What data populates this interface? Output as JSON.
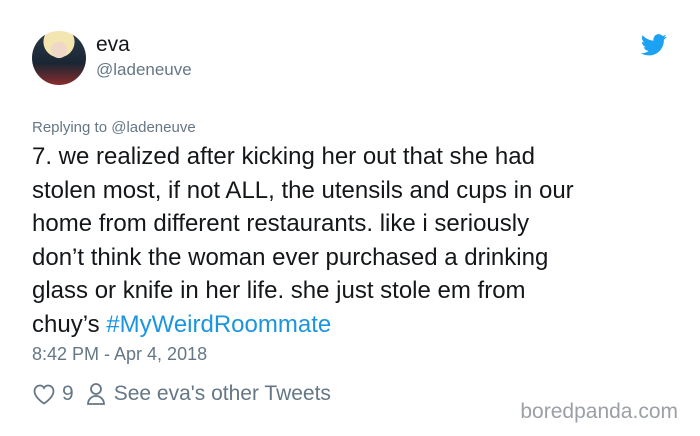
{
  "tweet": {
    "author_name": "eva",
    "author_handle": "@ladeneuve",
    "replying_to": "Replying to @ladeneuve",
    "text_main": "7. we realized after kicking her out that she had\nstolen most, if not ALL, the utensils and cups in our\nhome from different restaurants. like i seriously\ndon’t think the woman ever purchased a drinking\nglass or knife in her life. she just stole em from\nchuy’s ",
    "hashtag": "#MyWeirdRoommate",
    "timestamp": "8:42 PM - Apr 4, 2018",
    "like_count": "9",
    "see_more": "See eva's other Tweets"
  },
  "icons": {
    "brand": "twitter-bird-icon",
    "like": "heart-icon",
    "profile": "person-icon"
  },
  "colors": {
    "link": "#1b95e0",
    "muted": "#657786",
    "brand": "#1da1f2"
  },
  "watermark": "boredpanda.com"
}
